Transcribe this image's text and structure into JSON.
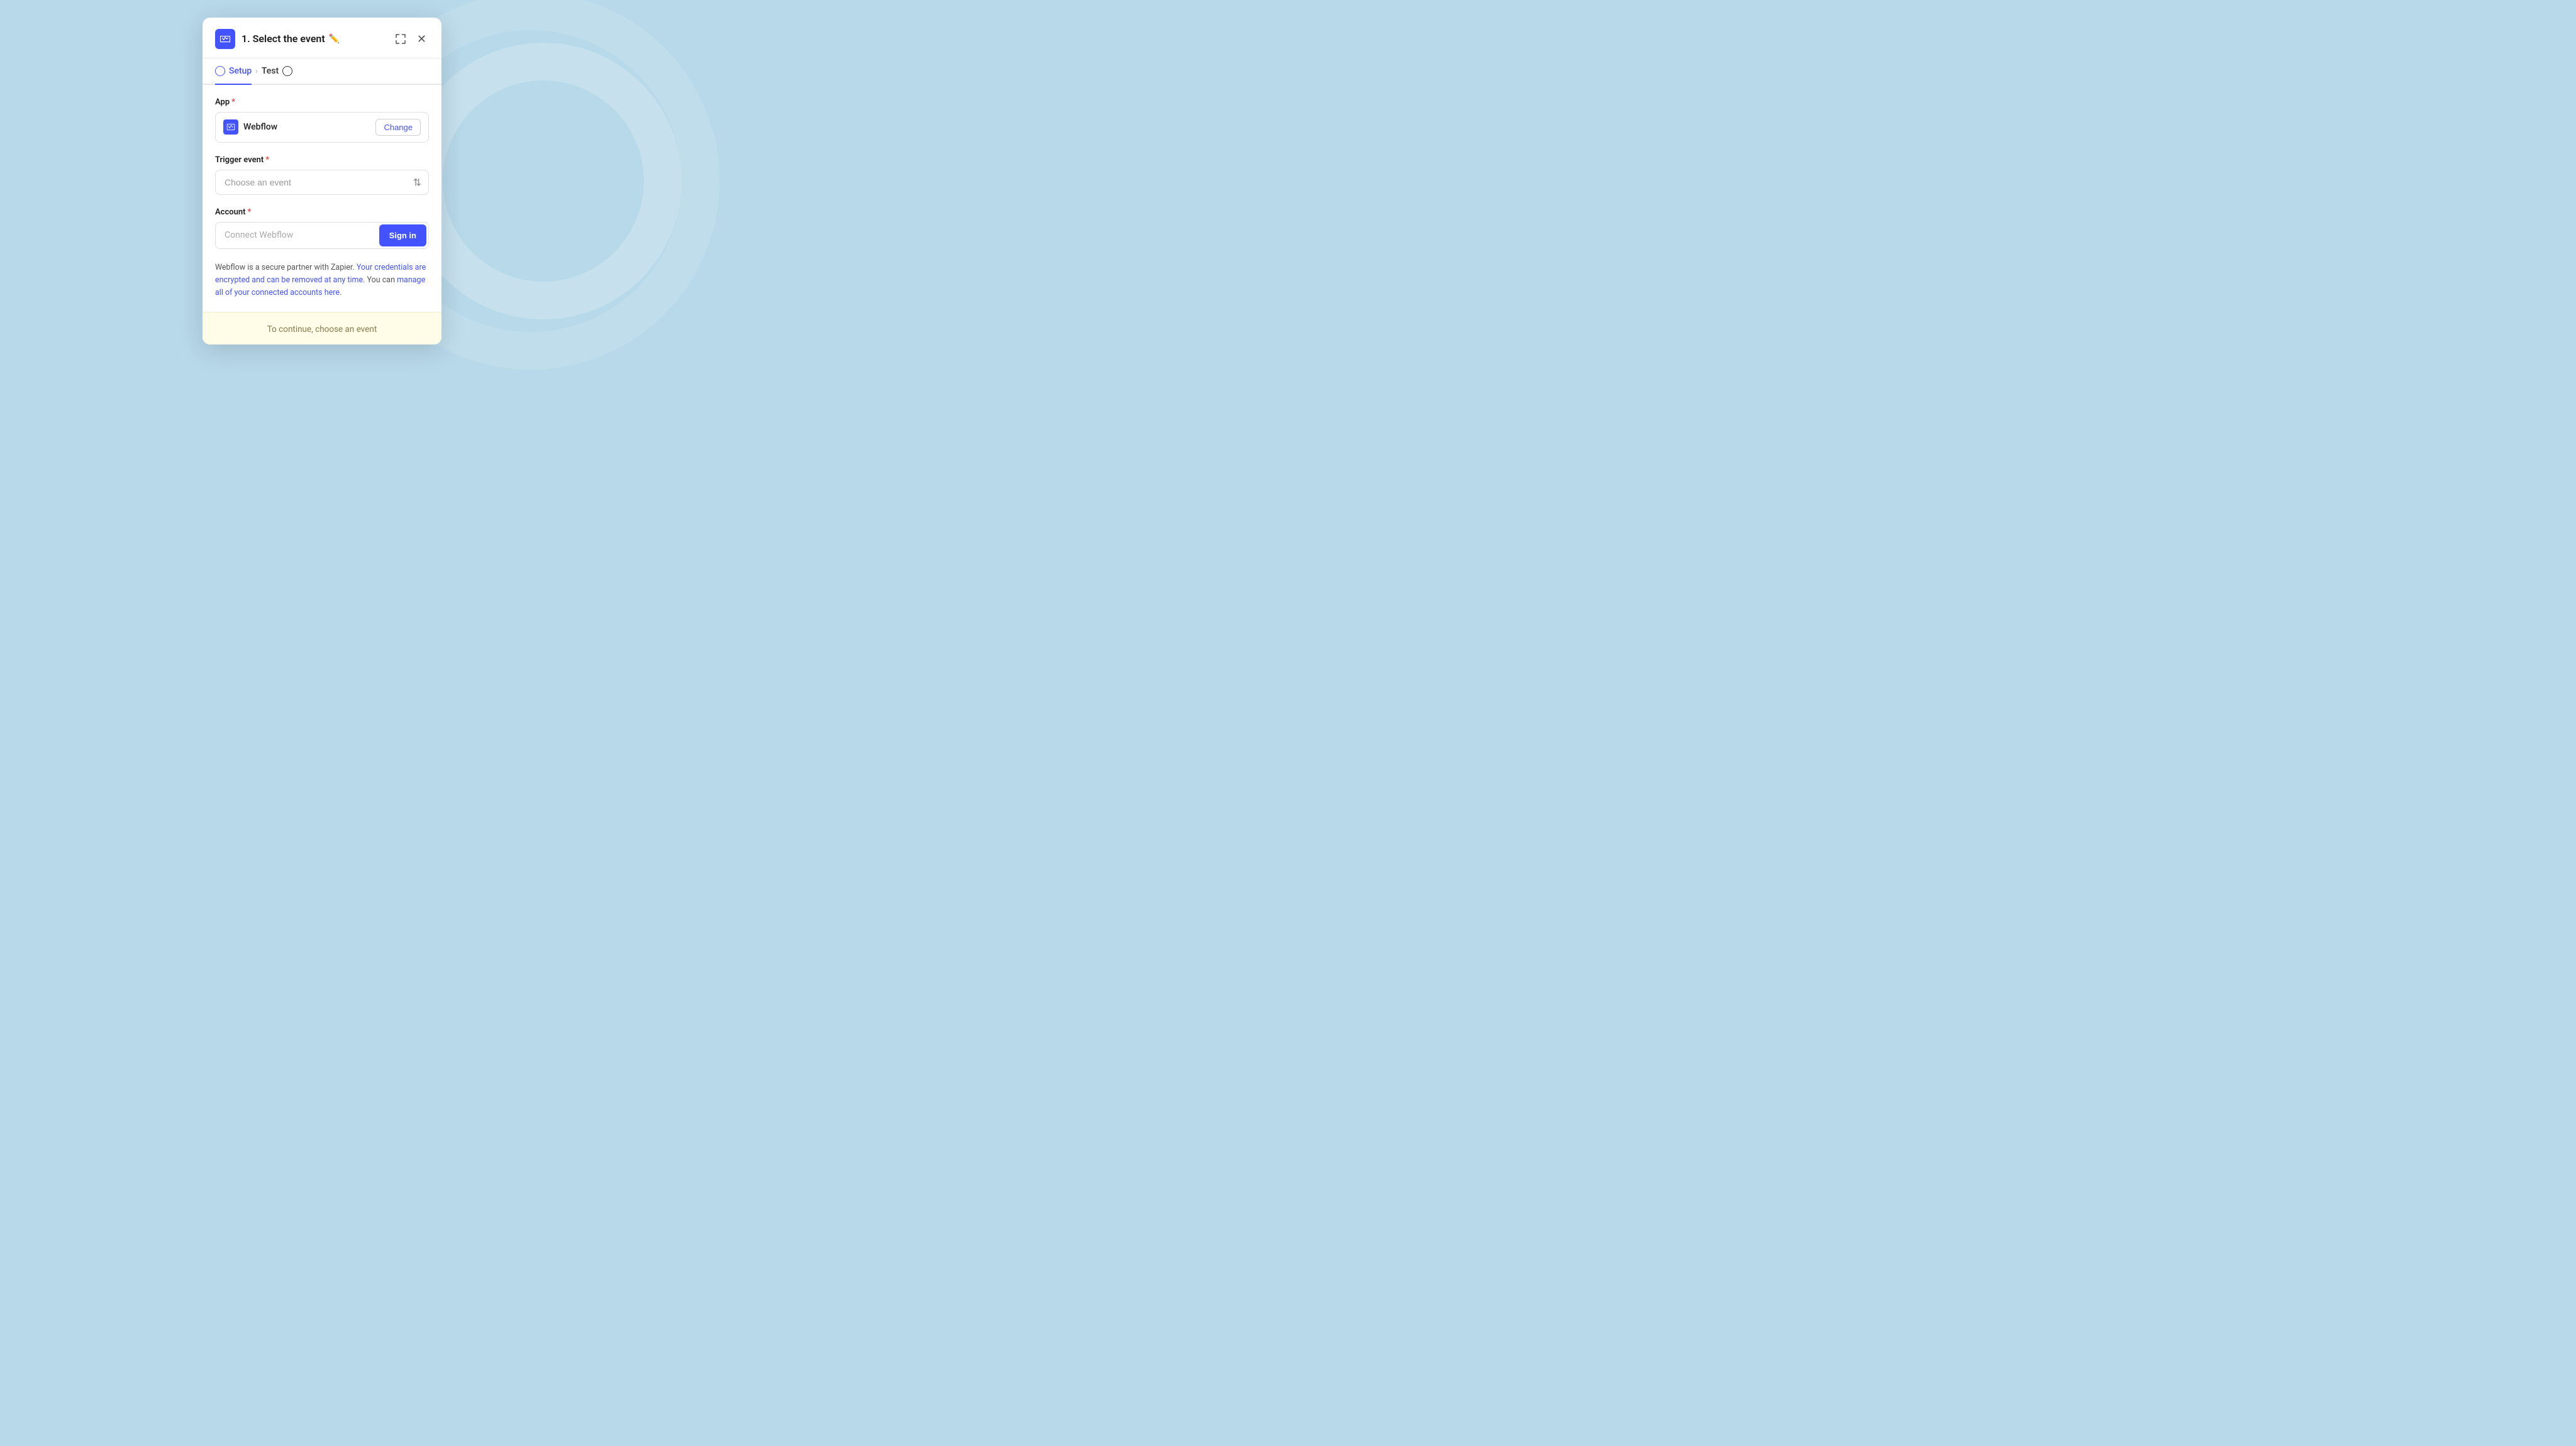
{
  "modal": {
    "title": "1. Select the event",
    "tabs": [
      {
        "label": "Setup",
        "active": true
      },
      {
        "label": "Test",
        "active": false
      }
    ],
    "app_section": {
      "label": "App",
      "required": true,
      "app_name": "Webflow",
      "change_button": "Change"
    },
    "trigger_section": {
      "label": "Trigger event",
      "required": true,
      "placeholder": "Choose an event"
    },
    "account_section": {
      "label": "Account",
      "required": true,
      "placeholder": "Connect Webflow",
      "signin_button": "Sign in"
    },
    "info_text_start": "Webflow is a secure partner with Zapier. ",
    "info_link1": "Your credentials are encrypted and can be removed at any time",
    "info_text_mid": ". You can ",
    "info_link2": "manage all of your connected accounts here",
    "info_text_end": ".",
    "footer_text": "To continue, choose an event"
  }
}
